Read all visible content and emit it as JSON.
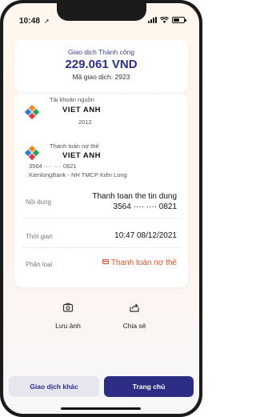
{
  "status_bar": {
    "time": "10:48",
    "location_arrow": "➚",
    "icons": [
      "signal-icon",
      "wifi-icon",
      "battery-icon"
    ]
  },
  "receipt": {
    "status_label": "Giao dịch Thành công",
    "amount": "229.061 VND",
    "transaction_code": "Mã giao dịch: 2923",
    "source": {
      "label": "Tài khoản nguồn",
      "name": "VIET  ANH",
      "account": "2012",
      "icon": "bank-logo-icon"
    },
    "destination": {
      "label": "Thanh toán nợ thẻ",
      "name": "VIET  ANH",
      "card": "3564 ···· ···· 0821",
      "bank": "KienlongBank - NH TMCP Kiên Long",
      "icon": "bank-logo-icon"
    },
    "rows": [
      {
        "label": "Nội dung",
        "value_line1": "Thanh toan the tin dung",
        "value_line2": "3564 ···· ···· 0821"
      },
      {
        "label": "Thời gian",
        "value": "10:47 08/12/2021"
      },
      {
        "label": "Phân loại",
        "value": "Thanh toán nợ thẻ",
        "icon": "card-icon"
      }
    ]
  },
  "actions": [
    {
      "label": "Lưu ảnh",
      "icon": "camera-icon"
    },
    {
      "label": "Chia sẻ",
      "icon": "share-icon"
    }
  ],
  "buttons": {
    "secondary": "Giao dịch khác",
    "primary": "Trang chủ"
  },
  "colors": {
    "primary": "#2c2e86",
    "accent_orange": "#e8502a",
    "background_tint": "#fff5ed"
  }
}
